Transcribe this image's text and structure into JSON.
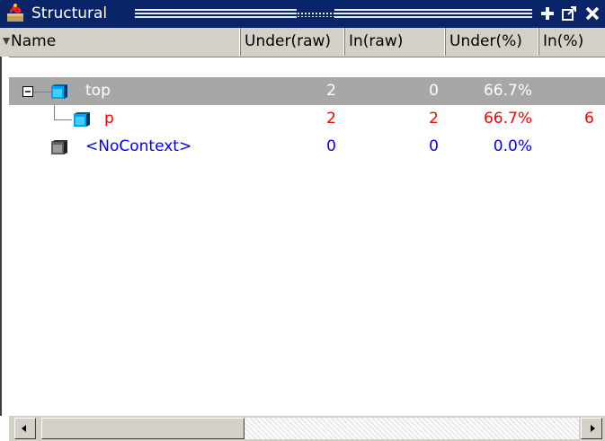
{
  "window": {
    "title": "Structural",
    "icons": [
      "app-icon",
      "add-view-icon",
      "undock-icon",
      "close-icon"
    ],
    "colors": {
      "titlebar": "#0a246a",
      "selection": "#a7a7a7",
      "red": "#ff0000",
      "blue": "#0000ff"
    }
  },
  "table": {
    "columns": [
      {
        "key": "name",
        "label": "Name"
      },
      {
        "key": "under_raw",
        "label": "Under(raw)"
      },
      {
        "key": "in_raw",
        "label": "In(raw)"
      },
      {
        "key": "under_pct",
        "label": "Under(%)"
      },
      {
        "key": "in_pct",
        "label": "In(%)"
      }
    ],
    "rows": [
      {
        "name": "top",
        "under_raw": "2",
        "in_raw": "0",
        "under_pct": "66.7%",
        "in_pct": "",
        "selected": true,
        "color": "#ffffff"
      },
      {
        "name": "p",
        "under_raw": "2",
        "in_raw": "2",
        "under_pct": "66.7%",
        "in_pct": "6",
        "selected": false,
        "color": "#ff0000"
      },
      {
        "name": "<NoContext>",
        "under_raw": "0",
        "in_raw": "0",
        "under_pct": "0.0%",
        "in_pct": "",
        "selected": false,
        "color": "#0000ff"
      }
    ]
  }
}
